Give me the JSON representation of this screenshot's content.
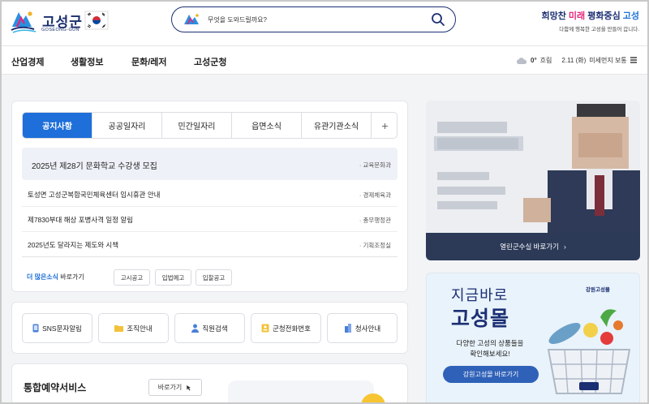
{
  "header": {
    "logo_text": "고성군",
    "logo_sub": "GOSEONG-GUN",
    "search_placeholder": "무엇을 도와드릴까요?",
    "slogan_part1": "희망찬 ",
    "slogan_mirae": "미래",
    "slogan_part2": " 평화중심 ",
    "slogan_goseong": "고성",
    "slogan_sub": "다함께 행복한 고성을 만들어 갑니다."
  },
  "nav": {
    "items": [
      "산업경제",
      "생활정보",
      "문화/레저",
      "고성군청"
    ],
    "weather_temp": "0°",
    "weather_desc": "흐림",
    "date": "2.11 (화)",
    "dust": "미세먼지 보통"
  },
  "notice": {
    "tabs": [
      "공지사항",
      "공공일자리",
      "민간일자리",
      "읍면소식",
      "유관기관소식"
    ],
    "add_tab": "+",
    "rows": [
      {
        "title": "2025년 제28기 문화학교 수강생 모집",
        "dept": "· 교육문화과"
      },
      {
        "title": "토성면 고성군복합국민체육센터 임시휴관 안내",
        "dept": "· 경제체육과"
      },
      {
        "title": "제7830부대 해상 포병사격 일정 알림",
        "dept": "· 총무행정관"
      },
      {
        "title": "2025년도 달라지는 제도와 시책",
        "dept": "· 기획조정실"
      }
    ],
    "more_bold": "더 많은소식",
    "more_rest": " 바로가기",
    "pills": [
      "고시공고",
      "입법예고",
      "입찰공고"
    ]
  },
  "quick": {
    "buttons": [
      "SNS문자알림",
      "조직안내",
      "직원검색",
      "군청전화번호",
      "청사안내"
    ]
  },
  "reserve": {
    "title": "통합예약서비스",
    "button": "바로가기"
  },
  "mayor": {
    "bar_label": "열린군수실 바로가기",
    "bar_arrow": "›"
  },
  "banner": {
    "brand": "강원고성몰",
    "headline1": "지금바로",
    "headline2": "고성몰",
    "desc_line1": "다양한 고성의 상품들을",
    "desc_line2": "확인해보세요!",
    "button": "강원고성몰 바로가기"
  },
  "colors": {
    "primary": "#1e6fd9",
    "navy": "#1b2f73",
    "accent_pink": "#e5267a"
  }
}
